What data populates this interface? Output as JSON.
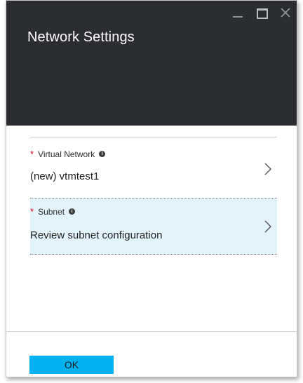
{
  "blade": {
    "title": "Network Settings"
  },
  "fields": [
    {
      "label": "Virtual Network",
      "required_marker": "*",
      "value": "(new) vtmtest1",
      "icon": "info-icon"
    },
    {
      "label": "Subnet",
      "required_marker": "*",
      "value": "Review subnet configuration",
      "icon": "info-icon"
    }
  ],
  "footer": {
    "ok_label": "OK"
  },
  "colors": {
    "header_bg": "#2a2e33",
    "accent_button": "#00b2f0",
    "selected_row_bg": "#e3f3fb",
    "required": "#d9001b"
  }
}
